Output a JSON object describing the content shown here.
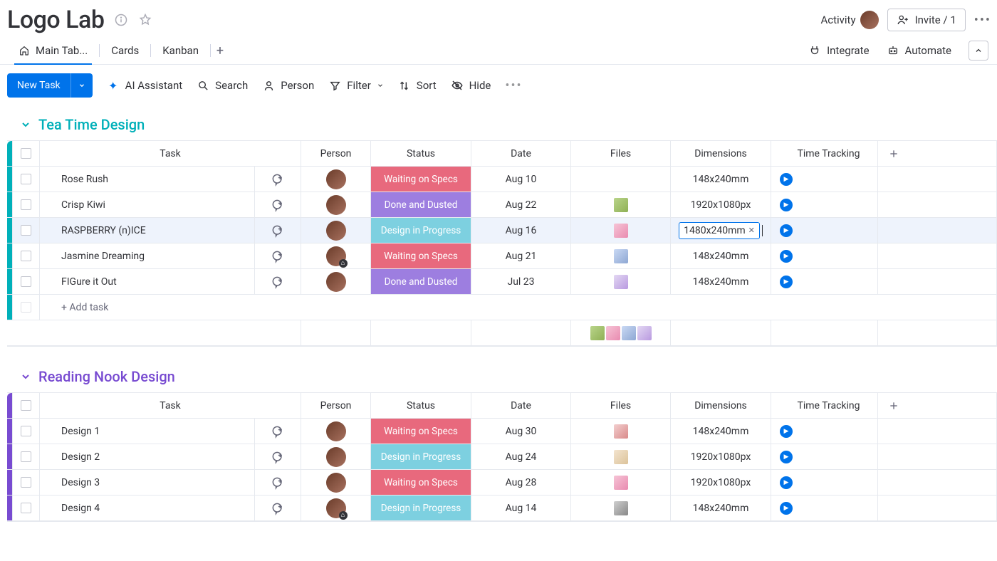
{
  "header": {
    "title": "Logo Lab",
    "activity_label": "Activity",
    "invite_label": "Invite / 1"
  },
  "views": {
    "main": "Main Tab...",
    "cards": "Cards",
    "kanban": "Kanban",
    "integrate": "Integrate",
    "automate": "Automate"
  },
  "toolbar": {
    "new_task": "New Task",
    "ai": "AI Assistant",
    "search": "Search",
    "person": "Person",
    "filter": "Filter",
    "sort": "Sort",
    "hide": "Hide"
  },
  "columns": {
    "task": "Task",
    "person": "Person",
    "status": "Status",
    "date": "Date",
    "files": "Files",
    "dimensions": "Dimensions",
    "timetracking": "Time Tracking"
  },
  "add_task": "+ Add task",
  "groups": [
    {
      "name": "Tea Time Design",
      "color": "teal",
      "rows": [
        {
          "task": "Rose Rush",
          "status": "Waiting on Specs",
          "status_cls": "st-wait",
          "date": "Aug 10",
          "file": "",
          "dim": "148x240mm",
          "home": false
        },
        {
          "task": "Crisp Kiwi",
          "status": "Done and Dusted",
          "status_cls": "st-done",
          "date": "Aug 22",
          "file": "ft-green",
          "dim": "1920x1080px",
          "home": false
        },
        {
          "task": "RASPBERRY (n)ICE",
          "status": "Design in Progress",
          "status_cls": "st-prog",
          "date": "Aug 16",
          "file": "ft-pink",
          "dim": "1480x240mm",
          "home": false,
          "active": true,
          "editing": true
        },
        {
          "task": "Jasmine Dreaming",
          "status": "Waiting on Specs",
          "status_cls": "st-wait",
          "date": "Aug 21",
          "file": "ft-blue",
          "dim": "148x240mm",
          "home": true
        },
        {
          "task": "FIGure it Out",
          "status": "Done and Dusted",
          "status_cls": "st-done",
          "date": "Jul 23",
          "file": "ft-lav",
          "dim": "148x240mm",
          "home": false
        }
      ]
    },
    {
      "name": "Reading Nook Design",
      "color": "purple",
      "rows": [
        {
          "task": "Design 1",
          "status": "Waiting on Specs",
          "status_cls": "st-wait",
          "date": "Aug 30",
          "file": "ft-rose",
          "dim": "148x240mm",
          "home": false
        },
        {
          "task": "Design 2",
          "status": "Design in Progress",
          "status_cls": "st-prog",
          "date": "Aug 24",
          "file": "ft-cream",
          "dim": "1920x1080px",
          "home": false
        },
        {
          "task": "Design 3",
          "status": "Waiting on Specs",
          "status_cls": "st-wait",
          "date": "Aug 28",
          "file": "ft-pink",
          "dim": "1920x1080px",
          "home": false
        },
        {
          "task": "Design 4",
          "status": "Design in Progress",
          "status_cls": "st-prog",
          "date": "Aug 14",
          "file": "ft-grey",
          "dim": "148x240mm",
          "home": true
        }
      ]
    }
  ],
  "summary_files": [
    "ft-green",
    "ft-pink",
    "ft-blue",
    "ft-lav"
  ]
}
